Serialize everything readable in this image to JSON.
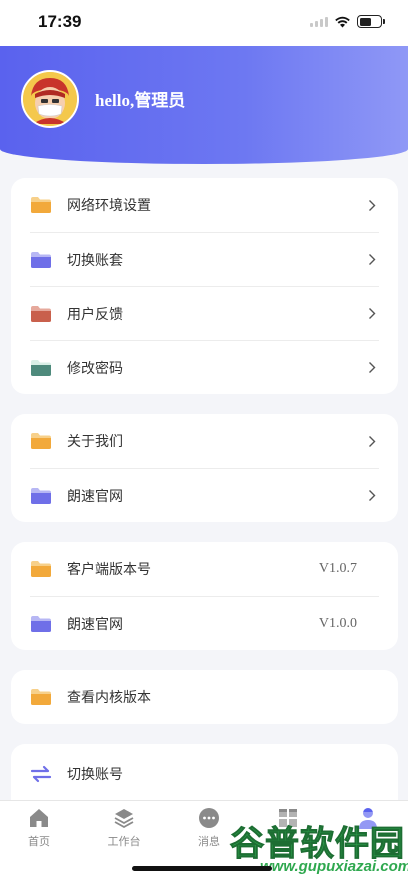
{
  "status_bar": {
    "time": "17:39"
  },
  "profile": {
    "greeting": "hello,管理员"
  },
  "settings_group_1": [
    {
      "label": "网络环境设置",
      "icon": "folder-orange-icon"
    },
    {
      "label": "切换账套",
      "icon": "folder-purple-icon"
    },
    {
      "label": "用户反馈",
      "icon": "folder-red-icon"
    },
    {
      "label": "修改密码",
      "icon": "folder-green-icon"
    }
  ],
  "settings_group_2": [
    {
      "label": "关于我们",
      "icon": "folder-orange-icon"
    },
    {
      "label": "朗速官网",
      "icon": "folder-purple-icon"
    }
  ],
  "version_group": [
    {
      "label": "客户端版本号",
      "value": "V1.0.7",
      "icon": "folder-orange-icon"
    },
    {
      "label": "朗速官网",
      "value": "V1.0.0",
      "icon": "folder-purple-icon"
    }
  ],
  "kernel_group": [
    {
      "label": "查看内核版本",
      "icon": "folder-orange-icon"
    }
  ],
  "switch_group": [
    {
      "label": "切换账号",
      "icon": "swap-icon"
    }
  ],
  "tabbar": {
    "items": [
      {
        "label": "首页",
        "icon": "home-icon"
      },
      {
        "label": "工作台",
        "icon": "layers-icon"
      },
      {
        "label": "消息",
        "icon": "chat-bubble-icon"
      },
      {
        "label": "",
        "icon": "grid-icon"
      },
      {
        "label": "",
        "icon": "person-icon",
        "active": true
      }
    ]
  },
  "watermark": {
    "main": "谷普软件园",
    "sub": "www.gupuxiazai.com"
  },
  "colors": {
    "accent": "#5a62ee",
    "folder_orange": "#f2a93b",
    "folder_purple": "#6f6fe8",
    "folder_red": "#c9604c",
    "folder_green": "#4e8a7c"
  }
}
